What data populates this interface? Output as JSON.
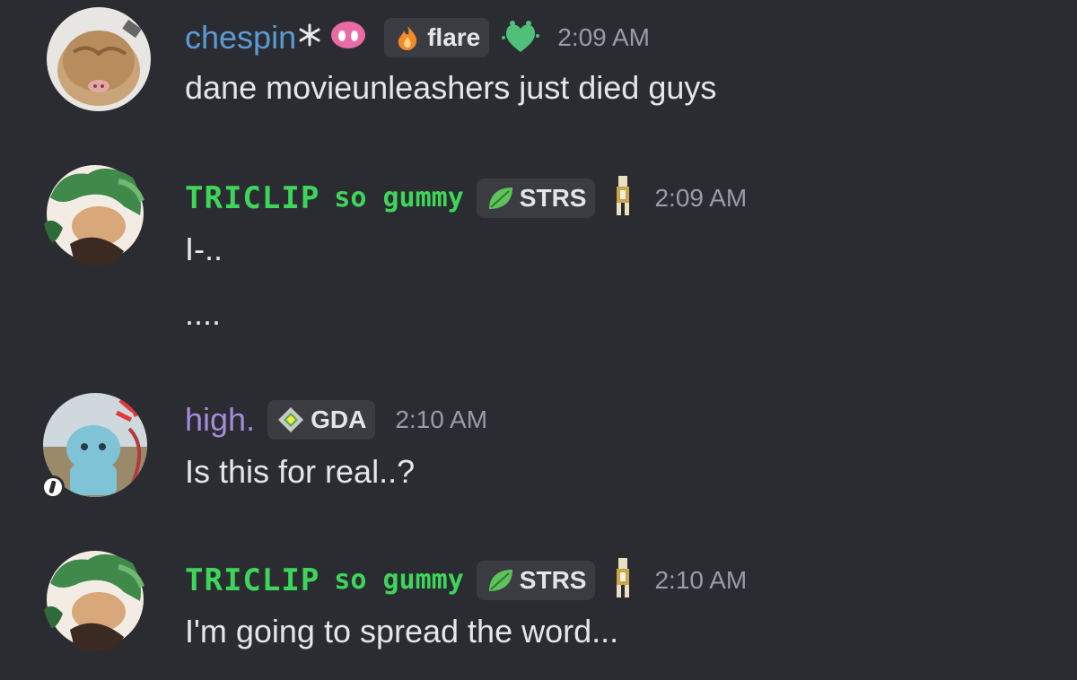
{
  "messages": [
    {
      "username": "chespin",
      "tag": "flare",
      "timestamp": "2:09 AM",
      "lines": [
        "dane movieunleashers just died guys"
      ]
    },
    {
      "username": "TRICLIP",
      "username_suffix": "so gummy",
      "tag": "STRS",
      "timestamp": "2:09 AM",
      "lines": [
        "I-..",
        "...."
      ]
    },
    {
      "username": "high.",
      "tag": "GDA",
      "timestamp": "2:10 AM",
      "lines": [
        "Is this for real..?"
      ]
    },
    {
      "username": "TRICLIP",
      "username_suffix": "so gummy",
      "tag": "STRS",
      "timestamp": "2:10 AM",
      "lines": [
        "I'm going to spread the word..."
      ]
    }
  ],
  "icons": {
    "chespin_decor": [
      "snowflake-icon",
      "pig-nose-icon"
    ],
    "flare_tag": "flame-icon",
    "chespin_extra": "green-sparkle-heart-icon",
    "strs_tag": "leaf-icon",
    "triclip_extra": "pixel-character-icon",
    "gda_tag": "diamond-cross-icon"
  },
  "colors": {
    "background": "#2b2c31",
    "chespin": "#5b9bd5",
    "triclip": "#3ed65a",
    "high": "#a78bdb",
    "timestamp": "#9a9ca3",
    "tag_bg": "#3a3c42"
  }
}
